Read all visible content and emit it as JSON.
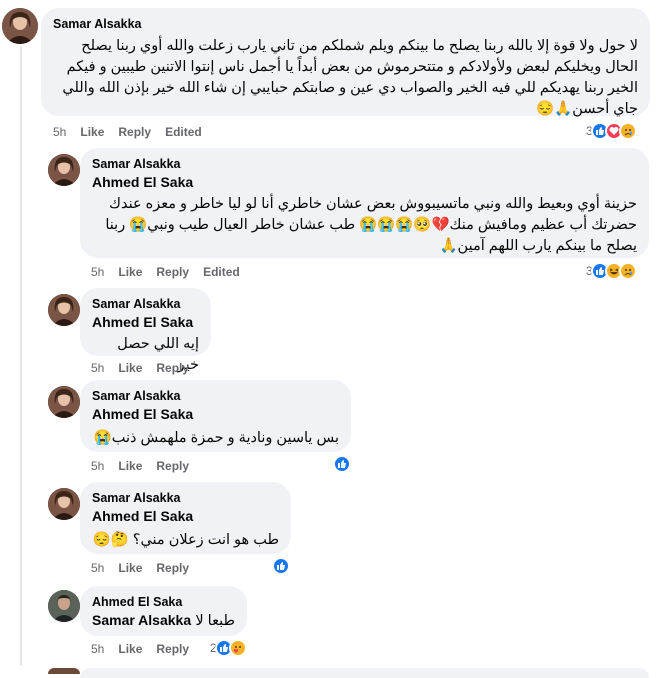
{
  "comments": [
    {
      "author": "Samar Alsakka",
      "mention": "",
      "text": "لا حول ولا قوة إلا بالله ربنا يصلح ما بينكم ويلم شملكم من تاني يارب زعلت والله أوي ربنا يصلح الحال ويخليكم لبعض ولأولادكم و متتحرموش من بعض أبداً يا أجمل ناس إنتوا الاتنين طيبين و فيكم الخير ربنا يهديكم للي فيه الخير والصواب دي عين و صابتكم حبايبي إن شاء الله خير بإذن الله واللي جاي أحسن🙏😔",
      "time": "5h",
      "like": "Like",
      "reply": "Reply",
      "edited": "Edited",
      "reaction_count": "3",
      "reactions": [
        "like-icon",
        "love-icon",
        "sad-icon"
      ]
    },
    {
      "author": "Samar Alsakka",
      "mention": "Ahmed El Saka",
      "text": "حزينة أوي وبعيط والله ونبي ماتسيبووش بعض عشان خاطري أنا لو ليا خاطر و معزه عندك حضرتك أب عظيم ومافيش منك💔🥺😭😭😭 طب عشان خاطر العيال طيب ونبي😭 ربنا يصلح ما بينكم يارب اللهم آمين🙏",
      "time": "5h",
      "like": "Like",
      "reply": "Reply",
      "edited": "Edited",
      "reaction_count": "3",
      "reactions": [
        "like-icon",
        "haha-icon",
        "sad-icon"
      ]
    },
    {
      "author": "Samar Alsakka",
      "mention": "Ahmed El Saka",
      "text": "إيه اللي حصل خير",
      "time": "5h",
      "like": "Like",
      "reply": "Reply"
    },
    {
      "author": "Samar Alsakka",
      "mention": "Ahmed El Saka",
      "text": "بس ياسين ونادية و حمزة ملهمش ذنب😭",
      "time": "5h",
      "like": "Like",
      "reply": "Reply",
      "reactions": [
        "like-icon"
      ]
    },
    {
      "author": "Samar Alsakka",
      "mention": "Ahmed El Saka",
      "text": "طب هو انت زعلان مني؟ 🤔😔",
      "time": "5h",
      "like": "Like",
      "reply": "Reply",
      "reactions": [
        "like-icon"
      ]
    },
    {
      "author": "Ahmed El Saka",
      "mention": "Samar Alsakka",
      "text": "طبعا لا",
      "time": "5h",
      "like": "Like",
      "reply": "Reply",
      "reaction_count": "2",
      "reactions": [
        "like-icon",
        "care-icon"
      ]
    }
  ],
  "colors": {
    "bubble": "#f0f2f5",
    "meta": "#65676b",
    "like_blue": "#1877f2",
    "love_red": "#f33e58",
    "emoji_yellow": "#f7b125"
  }
}
